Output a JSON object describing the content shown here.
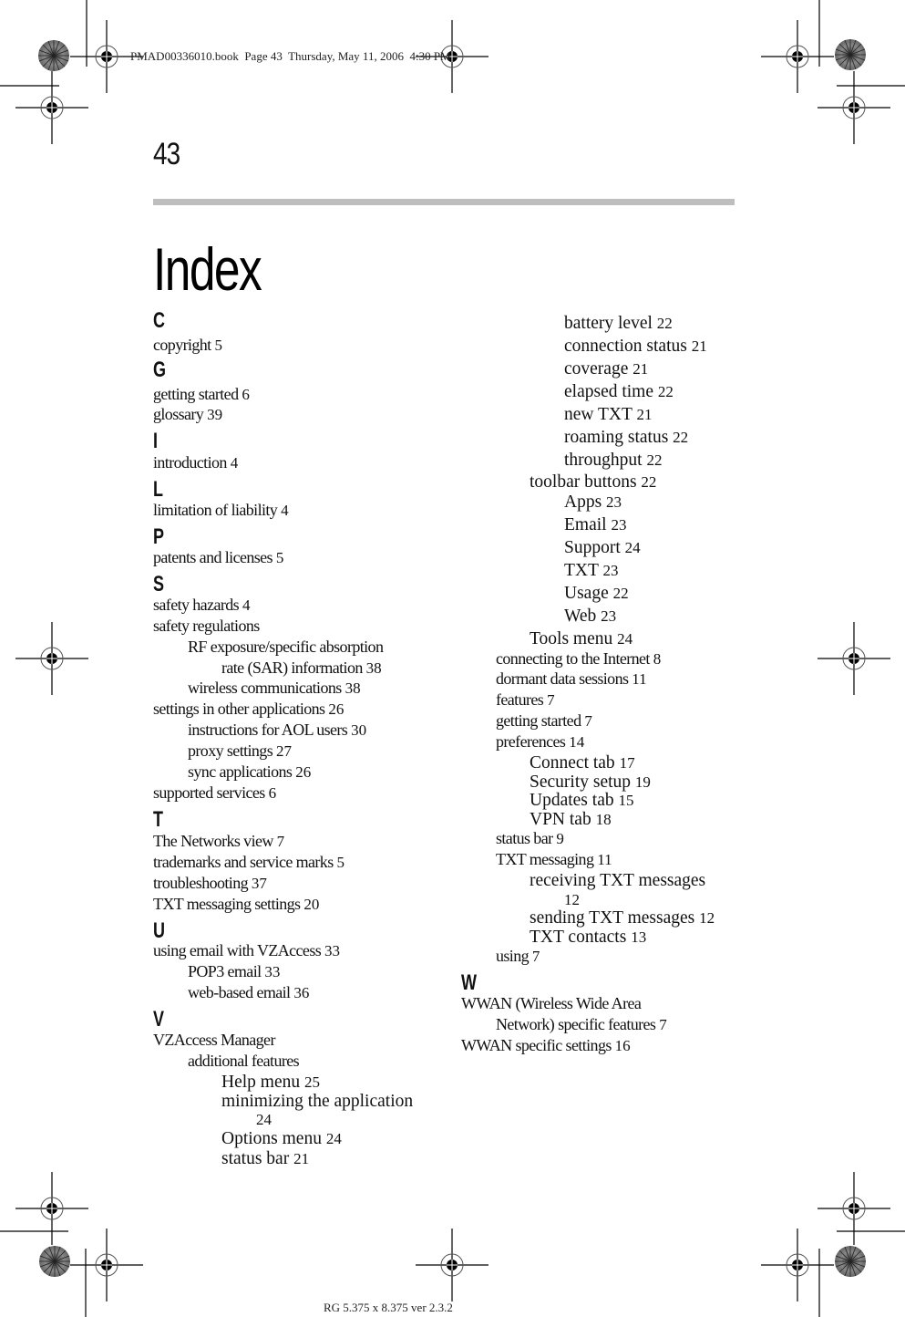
{
  "slug_line": "PMAD00336010.book  Page 43  Thursday, May 11, 2006  4:30 PM",
  "footer_line": "RG 5.375 x 8.375 ver 2.3.2",
  "page_number": "43",
  "title": "Index",
  "index": {
    "left_column": [
      {
        "type": "letter",
        "text": "C"
      },
      {
        "type": "entry",
        "level": 0,
        "text": "copyright",
        "page": "5"
      },
      {
        "type": "letter",
        "text": "G"
      },
      {
        "type": "entry",
        "level": 0,
        "text": "getting started",
        "page": "6"
      },
      {
        "type": "entry",
        "level": 0,
        "text": "glossary",
        "page": "39"
      },
      {
        "type": "letter",
        "text": "I"
      },
      {
        "type": "entry",
        "level": 0,
        "text": "introduction",
        "page": "4"
      },
      {
        "type": "letter",
        "text": "L"
      },
      {
        "type": "entry",
        "level": 0,
        "text": "limitation of liability",
        "page": "4"
      },
      {
        "type": "letter",
        "text": "P"
      },
      {
        "type": "entry",
        "level": 0,
        "text": "patents and licenses",
        "page": "5"
      },
      {
        "type": "letter",
        "text": "S"
      },
      {
        "type": "entry",
        "level": 0,
        "text": "safety hazards",
        "page": "4"
      },
      {
        "type": "entry",
        "level": 0,
        "text": "safety regulations",
        "page": ""
      },
      {
        "type": "entry",
        "level": 1,
        "text": "RF exposure/specific absorption",
        "page": ""
      },
      {
        "type": "entry",
        "level": 2,
        "text": "rate (SAR) information",
        "page": "38"
      },
      {
        "type": "entry",
        "level": 1,
        "text": "wireless communications",
        "page": "38"
      },
      {
        "type": "entry",
        "level": 0,
        "text": "settings in other applications",
        "page": "26"
      },
      {
        "type": "entry",
        "level": 1,
        "text": "instructions for AOL users",
        "page": "30"
      },
      {
        "type": "entry",
        "level": 1,
        "text": "proxy settings",
        "page": "27"
      },
      {
        "type": "entry",
        "level": 1,
        "text": "sync applications",
        "page": "26"
      },
      {
        "type": "entry",
        "level": 0,
        "text": "supported services",
        "page": "6"
      },
      {
        "type": "letter",
        "text": "T"
      },
      {
        "type": "entry",
        "level": 0,
        "text": "The Networks view",
        "page": "7"
      },
      {
        "type": "entry",
        "level": 0,
        "text": "trademarks and service marks",
        "page": "5"
      },
      {
        "type": "entry",
        "level": 0,
        "text": "troubleshooting",
        "page": "37"
      },
      {
        "type": "entry",
        "level": 0,
        "text": "TXT messaging settings",
        "page": "20"
      },
      {
        "type": "letter",
        "text": "U"
      },
      {
        "type": "entry",
        "level": 0,
        "text": "using email with VZAccess",
        "page": "33"
      },
      {
        "type": "entry",
        "level": 1,
        "text": "POP3 email",
        "page": "33"
      },
      {
        "type": "entry",
        "level": 1,
        "text": "web-based email",
        "page": "36"
      },
      {
        "type": "letter",
        "text": "V"
      },
      {
        "type": "entry",
        "level": 0,
        "text": "VZAccess Manager",
        "page": ""
      },
      {
        "type": "entry",
        "level": 1,
        "text": "additional features",
        "page": ""
      },
      {
        "type": "entry",
        "level": 2,
        "text": "Help menu",
        "page": "25",
        "big": true
      },
      {
        "type": "entry",
        "level": 2,
        "text": "minimizing the application",
        "page": "",
        "big": true
      },
      {
        "type": "entry",
        "level": 3,
        "text": "",
        "page": "24",
        "big": true
      },
      {
        "type": "entry",
        "level": 2,
        "text": "Options menu",
        "page": "24",
        "big": true
      },
      {
        "type": "entry",
        "level": 2,
        "text": "status bar",
        "page": "21",
        "big": true
      }
    ],
    "right_column": [
      {
        "type": "entry",
        "level": 3,
        "text": "battery level",
        "page": "22",
        "big": true
      },
      {
        "type": "entry",
        "level": 3,
        "text": "connection status",
        "page": "21",
        "big": true
      },
      {
        "type": "entry",
        "level": 3,
        "text": "coverage",
        "page": "21",
        "big": true
      },
      {
        "type": "entry",
        "level": 3,
        "text": "elapsed time",
        "page": "22",
        "big": true
      },
      {
        "type": "entry",
        "level": 3,
        "text": "new TXT",
        "page": "21",
        "big": true
      },
      {
        "type": "entry",
        "level": 3,
        "text": "roaming status",
        "page": "22",
        "big": true
      },
      {
        "type": "entry",
        "level": 3,
        "text": "throughput",
        "page": "22",
        "big": true
      },
      {
        "type": "entry",
        "level": 2,
        "text": "toolbar buttons",
        "page": "22",
        "big": true
      },
      {
        "type": "entry",
        "level": 3,
        "text": "Apps",
        "page": "23",
        "big": true
      },
      {
        "type": "entry",
        "level": 3,
        "text": "Email",
        "page": "23",
        "big": true
      },
      {
        "type": "entry",
        "level": 3,
        "text": "Support",
        "page": "24",
        "big": true
      },
      {
        "type": "entry",
        "level": 3,
        "text": "TXT",
        "page": "23",
        "big": true
      },
      {
        "type": "entry",
        "level": 3,
        "text": "Usage",
        "page": "22",
        "big": true
      },
      {
        "type": "entry",
        "level": 3,
        "text": "Web",
        "page": "23",
        "big": true
      },
      {
        "type": "entry",
        "level": 2,
        "text": "Tools menu",
        "page": "24",
        "big": true
      },
      {
        "type": "entry",
        "level": 1,
        "text": "connecting to the Internet",
        "page": "8"
      },
      {
        "type": "entry",
        "level": 1,
        "text": "dormant data sessions",
        "page": "11"
      },
      {
        "type": "entry",
        "level": 1,
        "text": "features",
        "page": "7"
      },
      {
        "type": "entry",
        "level": 1,
        "text": "getting started",
        "page": "7"
      },
      {
        "type": "entry",
        "level": 1,
        "text": "preferences",
        "page": "14"
      },
      {
        "type": "entry",
        "level": 2,
        "text": "Connect tab",
        "page": "17",
        "big": true
      },
      {
        "type": "entry",
        "level": 2,
        "text": "Security setup",
        "page": "19",
        "big": true
      },
      {
        "type": "entry",
        "level": 2,
        "text": "Updates tab",
        "page": "15",
        "big": true
      },
      {
        "type": "entry",
        "level": 2,
        "text": "VPN tab",
        "page": "18",
        "big": true
      },
      {
        "type": "entry",
        "level": 1,
        "text": "status bar",
        "page": "9"
      },
      {
        "type": "entry",
        "level": 1,
        "text": "TXT messaging",
        "page": "11"
      },
      {
        "type": "entry",
        "level": 2,
        "text": "receiving TXT messages",
        "page": "",
        "big": true
      },
      {
        "type": "entry",
        "level": 3,
        "text": "",
        "page": "12",
        "big": true
      },
      {
        "type": "entry",
        "level": 2,
        "text": "sending TXT messages",
        "page": "12",
        "big": true
      },
      {
        "type": "entry",
        "level": 2,
        "text": "TXT contacts",
        "page": "13",
        "big": true
      },
      {
        "type": "entry",
        "level": 1,
        "text": "using",
        "page": "7"
      },
      {
        "type": "letter",
        "text": "W"
      },
      {
        "type": "entry",
        "level": 0,
        "text": "WWAN (Wireless Wide Area",
        "page": ""
      },
      {
        "type": "entry",
        "level": 1,
        "text": "Network) specific features",
        "page": "7"
      },
      {
        "type": "entry",
        "level": 0,
        "text": "WWAN specific settings",
        "page": "16"
      }
    ]
  }
}
